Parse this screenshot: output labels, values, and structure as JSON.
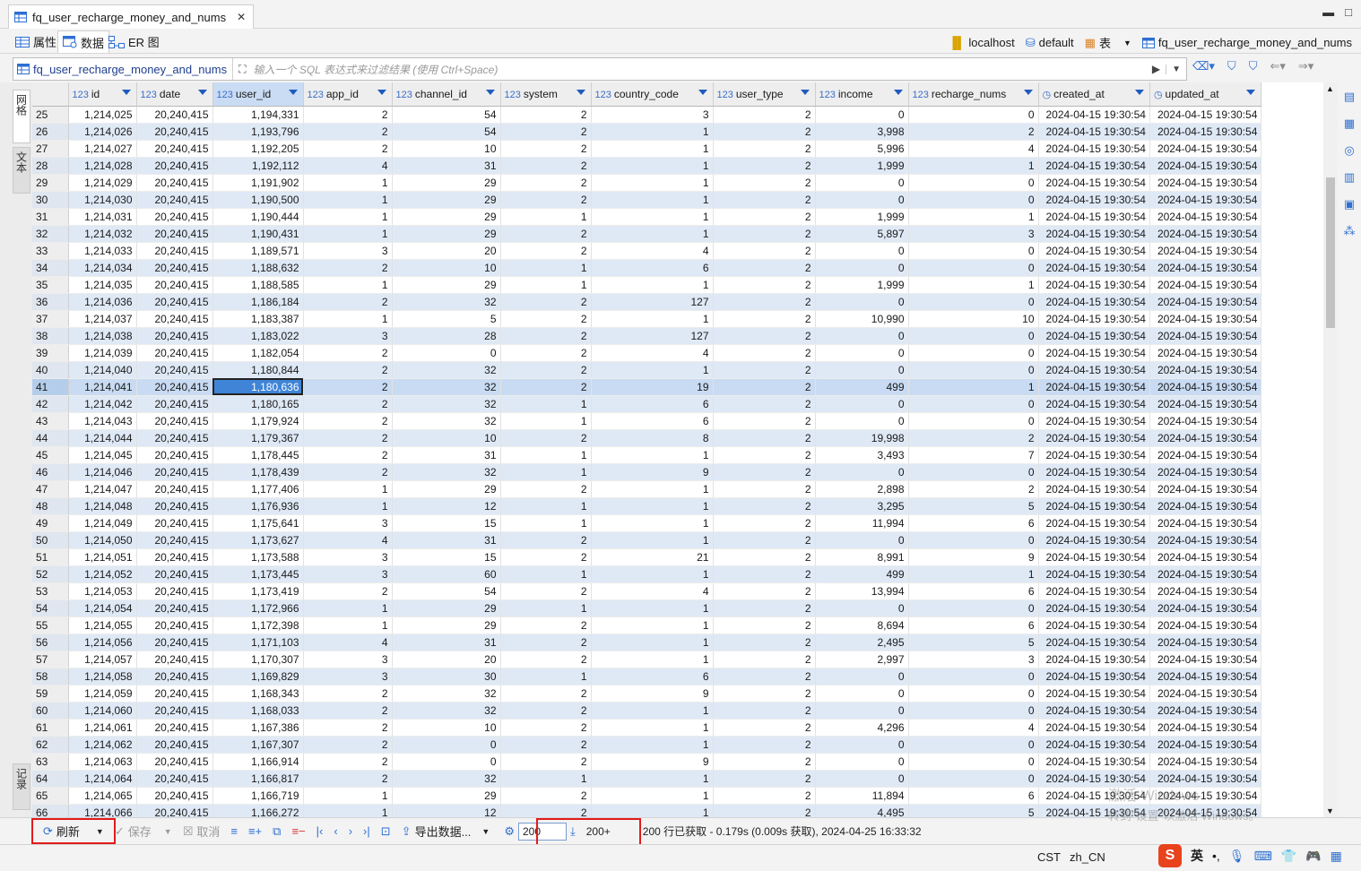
{
  "editor_tab": {
    "title": "fq_user_recharge_money_and_nums"
  },
  "subtabs": {
    "properties": "属性",
    "data": "数据",
    "er": "ER 图"
  },
  "connection": {
    "host": "localhost",
    "database": "default",
    "table_kind": "表",
    "table": "fq_user_recharge_money_and_nums"
  },
  "filter": {
    "table_label": "fq_user_recharge_money_and_nums",
    "placeholder": "输入一个 SQL 表达式来过滤结果 (使用 Ctrl+Space)"
  },
  "left_tabs": {
    "grid": "网格",
    "text": "文本",
    "record": "记录"
  },
  "columns": [
    {
      "type": "123",
      "name": "id"
    },
    {
      "type": "123",
      "name": "date"
    },
    {
      "type": "123",
      "name": "user_id"
    },
    {
      "type": "123",
      "name": "app_id"
    },
    {
      "type": "123",
      "name": "channel_id"
    },
    {
      "type": "123",
      "name": "system"
    },
    {
      "type": "123",
      "name": "country_code"
    },
    {
      "type": "123",
      "name": "user_type"
    },
    {
      "type": "123",
      "name": "income"
    },
    {
      "type": "123",
      "name": "recharge_nums"
    },
    {
      "type": "clock",
      "name": "created_at"
    },
    {
      "type": "clock",
      "name": "updated_at"
    }
  ],
  "rows": [
    [
      "25",
      "1,214,025",
      "20,240,415",
      "1,194,331",
      "2",
      "54",
      "2",
      "3",
      "2",
      "0",
      "0",
      "2024-04-15 19:30:54",
      "2024-04-15 19:30:54"
    ],
    [
      "26",
      "1,214,026",
      "20,240,415",
      "1,193,796",
      "2",
      "54",
      "2",
      "1",
      "2",
      "3,998",
      "2",
      "2024-04-15 19:30:54",
      "2024-04-15 19:30:54"
    ],
    [
      "27",
      "1,214,027",
      "20,240,415",
      "1,192,205",
      "2",
      "10",
      "2",
      "1",
      "2",
      "5,996",
      "4",
      "2024-04-15 19:30:54",
      "2024-04-15 19:30:54"
    ],
    [
      "28",
      "1,214,028",
      "20,240,415",
      "1,192,112",
      "4",
      "31",
      "2",
      "1",
      "2",
      "1,999",
      "1",
      "2024-04-15 19:30:54",
      "2024-04-15 19:30:54"
    ],
    [
      "29",
      "1,214,029",
      "20,240,415",
      "1,191,902",
      "1",
      "29",
      "2",
      "1",
      "2",
      "0",
      "0",
      "2024-04-15 19:30:54",
      "2024-04-15 19:30:54"
    ],
    [
      "30",
      "1,214,030",
      "20,240,415",
      "1,190,500",
      "1",
      "29",
      "2",
      "1",
      "2",
      "0",
      "0",
      "2024-04-15 19:30:54",
      "2024-04-15 19:30:54"
    ],
    [
      "31",
      "1,214,031",
      "20,240,415",
      "1,190,444",
      "1",
      "29",
      "1",
      "1",
      "2",
      "1,999",
      "1",
      "2024-04-15 19:30:54",
      "2024-04-15 19:30:54"
    ],
    [
      "32",
      "1,214,032",
      "20,240,415",
      "1,190,431",
      "1",
      "29",
      "2",
      "1",
      "2",
      "5,897",
      "3",
      "2024-04-15 19:30:54",
      "2024-04-15 19:30:54"
    ],
    [
      "33",
      "1,214,033",
      "20,240,415",
      "1,189,571",
      "3",
      "20",
      "2",
      "4",
      "2",
      "0",
      "0",
      "2024-04-15 19:30:54",
      "2024-04-15 19:30:54"
    ],
    [
      "34",
      "1,214,034",
      "20,240,415",
      "1,188,632",
      "2",
      "10",
      "1",
      "6",
      "2",
      "0",
      "0",
      "2024-04-15 19:30:54",
      "2024-04-15 19:30:54"
    ],
    [
      "35",
      "1,214,035",
      "20,240,415",
      "1,188,585",
      "1",
      "29",
      "1",
      "1",
      "2",
      "1,999",
      "1",
      "2024-04-15 19:30:54",
      "2024-04-15 19:30:54"
    ],
    [
      "36",
      "1,214,036",
      "20,240,415",
      "1,186,184",
      "2",
      "32",
      "2",
      "127",
      "2",
      "0",
      "0",
      "2024-04-15 19:30:54",
      "2024-04-15 19:30:54"
    ],
    [
      "37",
      "1,214,037",
      "20,240,415",
      "1,183,387",
      "1",
      "5",
      "2",
      "1",
      "2",
      "10,990",
      "10",
      "2024-04-15 19:30:54",
      "2024-04-15 19:30:54"
    ],
    [
      "38",
      "1,214,038",
      "20,240,415",
      "1,183,022",
      "3",
      "28",
      "2",
      "127",
      "2",
      "0",
      "0",
      "2024-04-15 19:30:54",
      "2024-04-15 19:30:54"
    ],
    [
      "39",
      "1,214,039",
      "20,240,415",
      "1,182,054",
      "2",
      "0",
      "2",
      "4",
      "2",
      "0",
      "0",
      "2024-04-15 19:30:54",
      "2024-04-15 19:30:54"
    ],
    [
      "40",
      "1,214,040",
      "20,240,415",
      "1,180,844",
      "2",
      "32",
      "2",
      "1",
      "2",
      "0",
      "0",
      "2024-04-15 19:30:54",
      "2024-04-15 19:30:54"
    ],
    [
      "41",
      "1,214,041",
      "20,240,415",
      "1,180,636",
      "2",
      "32",
      "2",
      "19",
      "2",
      "499",
      "1",
      "2024-04-15 19:30:54",
      "2024-04-15 19:30:54"
    ],
    [
      "42",
      "1,214,042",
      "20,240,415",
      "1,180,165",
      "2",
      "32",
      "1",
      "6",
      "2",
      "0",
      "0",
      "2024-04-15 19:30:54",
      "2024-04-15 19:30:54"
    ],
    [
      "43",
      "1,214,043",
      "20,240,415",
      "1,179,924",
      "2",
      "32",
      "1",
      "6",
      "2",
      "0",
      "0",
      "2024-04-15 19:30:54",
      "2024-04-15 19:30:54"
    ],
    [
      "44",
      "1,214,044",
      "20,240,415",
      "1,179,367",
      "2",
      "10",
      "2",
      "8",
      "2",
      "19,998",
      "2",
      "2024-04-15 19:30:54",
      "2024-04-15 19:30:54"
    ],
    [
      "45",
      "1,214,045",
      "20,240,415",
      "1,178,445",
      "2",
      "31",
      "1",
      "1",
      "2",
      "3,493",
      "7",
      "2024-04-15 19:30:54",
      "2024-04-15 19:30:54"
    ],
    [
      "46",
      "1,214,046",
      "20,240,415",
      "1,178,439",
      "2",
      "32",
      "1",
      "9",
      "2",
      "0",
      "0",
      "2024-04-15 19:30:54",
      "2024-04-15 19:30:54"
    ],
    [
      "47",
      "1,214,047",
      "20,240,415",
      "1,177,406",
      "1",
      "29",
      "2",
      "1",
      "2",
      "2,898",
      "2",
      "2024-04-15 19:30:54",
      "2024-04-15 19:30:54"
    ],
    [
      "48",
      "1,214,048",
      "20,240,415",
      "1,176,936",
      "1",
      "12",
      "1",
      "1",
      "2",
      "3,295",
      "5",
      "2024-04-15 19:30:54",
      "2024-04-15 19:30:54"
    ],
    [
      "49",
      "1,214,049",
      "20,240,415",
      "1,175,641",
      "3",
      "15",
      "1",
      "1",
      "2",
      "11,994",
      "6",
      "2024-04-15 19:30:54",
      "2024-04-15 19:30:54"
    ],
    [
      "50",
      "1,214,050",
      "20,240,415",
      "1,173,627",
      "4",
      "31",
      "2",
      "1",
      "2",
      "0",
      "0",
      "2024-04-15 19:30:54",
      "2024-04-15 19:30:54"
    ],
    [
      "51",
      "1,214,051",
      "20,240,415",
      "1,173,588",
      "3",
      "15",
      "2",
      "21",
      "2",
      "8,991",
      "9",
      "2024-04-15 19:30:54",
      "2024-04-15 19:30:54"
    ],
    [
      "52",
      "1,214,052",
      "20,240,415",
      "1,173,445",
      "3",
      "60",
      "1",
      "1",
      "2",
      "499",
      "1",
      "2024-04-15 19:30:54",
      "2024-04-15 19:30:54"
    ],
    [
      "53",
      "1,214,053",
      "20,240,415",
      "1,173,419",
      "2",
      "54",
      "2",
      "4",
      "2",
      "13,994",
      "6",
      "2024-04-15 19:30:54",
      "2024-04-15 19:30:54"
    ],
    [
      "54",
      "1,214,054",
      "20,240,415",
      "1,172,966",
      "1",
      "29",
      "1",
      "1",
      "2",
      "0",
      "0",
      "2024-04-15 19:30:54",
      "2024-04-15 19:30:54"
    ],
    [
      "55",
      "1,214,055",
      "20,240,415",
      "1,172,398",
      "1",
      "29",
      "2",
      "1",
      "2",
      "8,694",
      "6",
      "2024-04-15 19:30:54",
      "2024-04-15 19:30:54"
    ],
    [
      "56",
      "1,214,056",
      "20,240,415",
      "1,171,103",
      "4",
      "31",
      "2",
      "1",
      "2",
      "2,495",
      "5",
      "2024-04-15 19:30:54",
      "2024-04-15 19:30:54"
    ],
    [
      "57",
      "1,214,057",
      "20,240,415",
      "1,170,307",
      "3",
      "20",
      "2",
      "1",
      "2",
      "2,997",
      "3",
      "2024-04-15 19:30:54",
      "2024-04-15 19:30:54"
    ],
    [
      "58",
      "1,214,058",
      "20,240,415",
      "1,169,829",
      "3",
      "30",
      "1",
      "6",
      "2",
      "0",
      "0",
      "2024-04-15 19:30:54",
      "2024-04-15 19:30:54"
    ],
    [
      "59",
      "1,214,059",
      "20,240,415",
      "1,168,343",
      "2",
      "32",
      "2",
      "9",
      "2",
      "0",
      "0",
      "2024-04-15 19:30:54",
      "2024-04-15 19:30:54"
    ],
    [
      "60",
      "1,214,060",
      "20,240,415",
      "1,168,033",
      "2",
      "32",
      "2",
      "1",
      "2",
      "0",
      "0",
      "2024-04-15 19:30:54",
      "2024-04-15 19:30:54"
    ],
    [
      "61",
      "1,214,061",
      "20,240,415",
      "1,167,386",
      "2",
      "10",
      "2",
      "1",
      "2",
      "4,296",
      "4",
      "2024-04-15 19:30:54",
      "2024-04-15 19:30:54"
    ],
    [
      "62",
      "1,214,062",
      "20,240,415",
      "1,167,307",
      "2",
      "0",
      "2",
      "1",
      "2",
      "0",
      "0",
      "2024-04-15 19:30:54",
      "2024-04-15 19:30:54"
    ],
    [
      "63",
      "1,214,063",
      "20,240,415",
      "1,166,914",
      "2",
      "0",
      "2",
      "9",
      "2",
      "0",
      "0",
      "2024-04-15 19:30:54",
      "2024-04-15 19:30:54"
    ],
    [
      "64",
      "1,214,064",
      "20,240,415",
      "1,166,817",
      "2",
      "32",
      "1",
      "1",
      "2",
      "0",
      "0",
      "2024-04-15 19:30:54",
      "2024-04-15 19:30:54"
    ],
    [
      "65",
      "1,214,065",
      "20,240,415",
      "1,166,719",
      "1",
      "29",
      "2",
      "1",
      "2",
      "11,894",
      "6",
      "2024-04-15 19:30:54",
      "2024-04-15 19:30:54"
    ],
    [
      "66",
      "1,214,066",
      "20,240,415",
      "1,166,272",
      "1",
      "12",
      "2",
      "1",
      "2",
      "4,495",
      "5",
      "2024-04-15 19:30:54",
      "2024-04-15 19:30:54"
    ]
  ],
  "selected_row": "41",
  "bottom": {
    "refresh": "刷新",
    "save": "保存",
    "cancel": "取消",
    "export": "导出数据...",
    "fetch_size": "200",
    "more": "200+",
    "status": "200 行已获取 - 0.179s (0.009s 获取), 2024-04-25 16:33:32"
  },
  "statusline": {
    "timezone": "CST",
    "locale": "zh_CN"
  },
  "ime": {
    "mode": "英"
  },
  "watermark": {
    "line1": "激活 Windows",
    "line2": "转到\"设置\"以激活 Windows。"
  },
  "colors": {
    "accent": "#2d6fd3",
    "highlight_box": "#e21b1b",
    "row_alt": "#dfe9f6"
  }
}
